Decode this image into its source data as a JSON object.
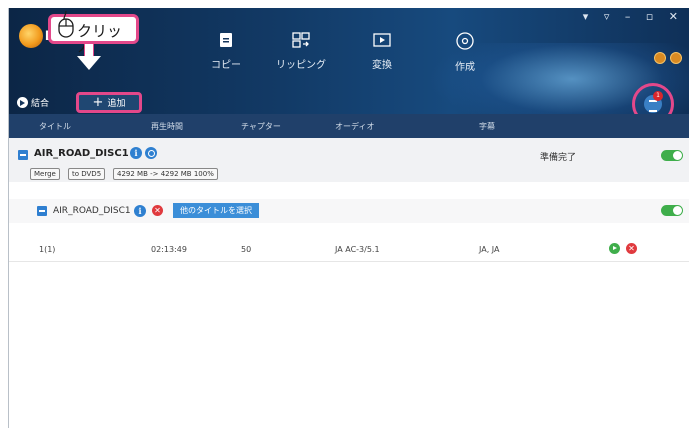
{
  "header": {
    "logo_letter": "D",
    "window_controls": "▾ ▿ – ▫ ✕",
    "nav": [
      {
        "label": "コピー",
        "icon": "copy-icon"
      },
      {
        "label": "リッピング",
        "icon": "ripping-icon"
      },
      {
        "label": "変換",
        "icon": "convert-icon"
      },
      {
        "label": "作成",
        "icon": "create-disc-icon"
      }
    ],
    "merge_label": "結合",
    "add_label": "追加",
    "queue_badge": "1"
  },
  "annotation": {
    "click_label": "クリック"
  },
  "columns": [
    "タイトル",
    "再生時間",
    "チャプター",
    "オーディオ",
    "字幕"
  ],
  "disc": {
    "title": "AIR_ROAD_DISC1",
    "tags": [
      "Merge",
      "to DVD5",
      "4292 MB -> 4292 MB 100%"
    ],
    "status": "準備完了"
  },
  "title_row": {
    "name": "AIR_ROAD_DISC1",
    "select_label": "他のタイトルを選択"
  },
  "track": {
    "title": "1(1)",
    "duration": "02:13:49",
    "chapters": "50",
    "audio": "JA AC-3/5.1",
    "subtitles": "JA, JA"
  }
}
